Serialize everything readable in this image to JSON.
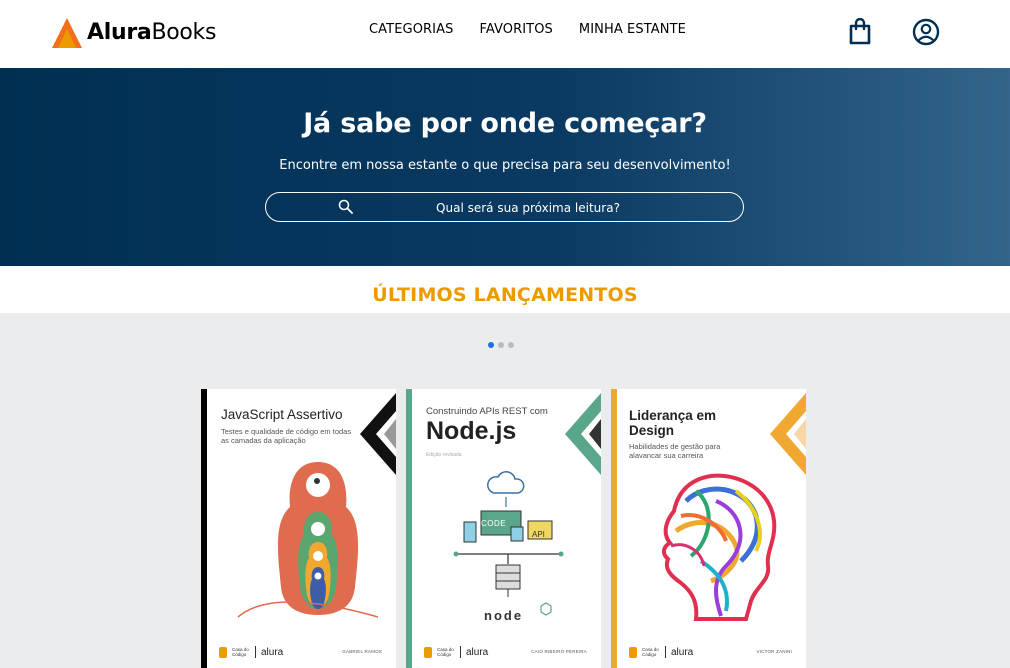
{
  "brand": {
    "part1": "Alura",
    "part2": "Books",
    "orange": "#EB9B00",
    "orange_dark": "#f26f1c"
  },
  "nav": {
    "items": [
      "CATEGORIAS",
      "FAVORITOS",
      "MINHA ESTANTE"
    ]
  },
  "header_icons": [
    "shopping-bag-icon",
    "user-account-icon"
  ],
  "hero": {
    "title": "Já sabe por onde começar?",
    "subtitle": "Encontre em nossa estante o que precisa para seu desenvolvimento!",
    "search_placeholder": "Qual será sua próxima leitura?",
    "bg_from": "#002F52",
    "bg_to": "#326589"
  },
  "section": {
    "title": "ÚLTIMOS LANÇAMENTOS",
    "color": "#EB9B00"
  },
  "carousel": {
    "pages": 3,
    "active_page": 1,
    "active_color": "#1e6ee6"
  },
  "books": [
    {
      "title": "JavaScript Assertivo",
      "subtitle": "Testes e qualidade de código em todas as camadas da aplicação",
      "author": "GABRIEL RAMOS",
      "spine_color": "#000000"
    },
    {
      "title_pre": "Construindo APIs REST com",
      "title": "Node.js",
      "edition": "Edição revisada",
      "code_label": "CODE",
      "api_label": "API",
      "node_logo": "node",
      "author": "CAIO RIBEIRO PEREIRA",
      "spine_color": "#5AA68A"
    },
    {
      "title": "Liderança em Design",
      "subtitle": "Habilidades de gestão para alavancar sua carreira",
      "author": "VICTOR ZANINI",
      "spine_color": "#F0A830"
    }
  ],
  "publisher": {
    "cdc": "Casa do Código",
    "alura": "alura"
  }
}
